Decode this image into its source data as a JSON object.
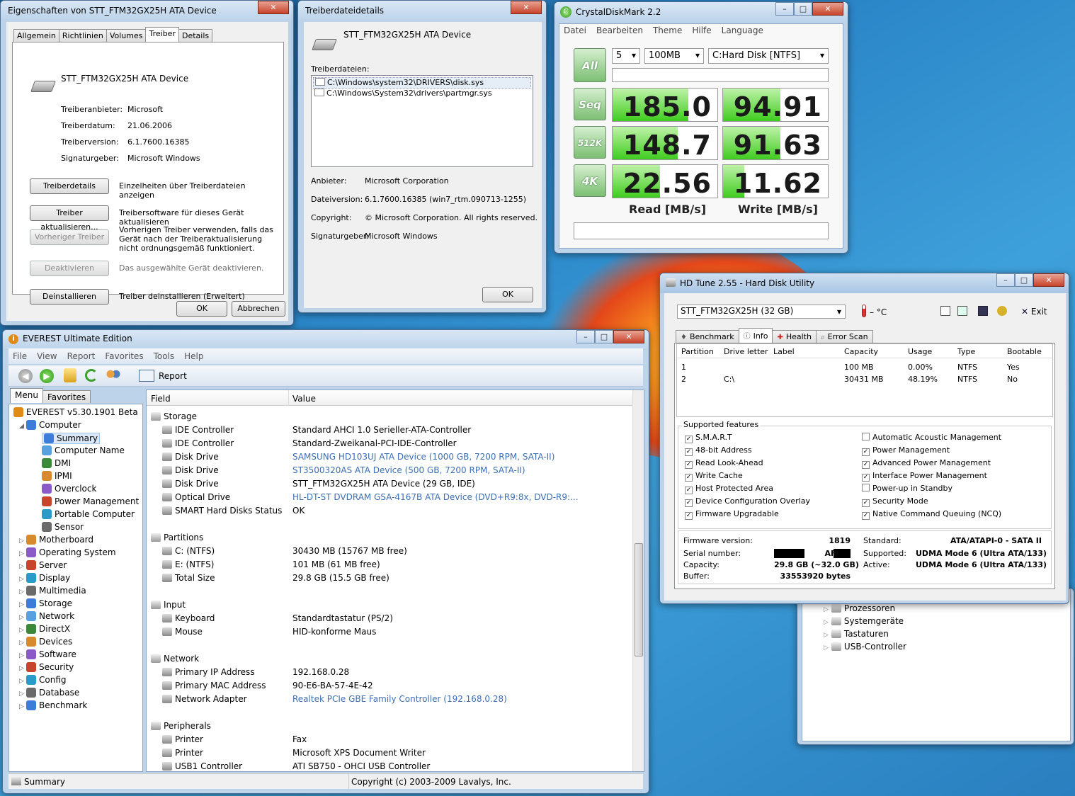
{
  "props": {
    "title": "Eigenschaften von STT_FTM32GX25H ATA Device",
    "tabs": [
      "Allgemein",
      "Richtlinien",
      "Volumes",
      "Treiber",
      "Details"
    ],
    "device": "STT_FTM32GX25H ATA Device",
    "fields": [
      {
        "k": "Treiberanbieter:",
        "v": "Microsoft"
      },
      {
        "k": "Treiberdatum:",
        "v": "21.06.2006"
      },
      {
        "k": "Treiberversion:",
        "v": "6.1.7600.16385"
      },
      {
        "k": "Signaturgeber:",
        "v": "Microsoft Windows"
      }
    ],
    "actions": [
      {
        "btn": "Treiberdetails",
        "desc": "Einzelheiten über Treiberdateien anzeigen"
      },
      {
        "btn": "Treiber aktualisieren...",
        "desc": "Treibersoftware für dieses Gerät aktualisieren"
      },
      {
        "btn": "Vorheriger Treiber",
        "desc": "Vorherigen Treiber verwenden, falls das Gerät nach der Treiberaktualisierung nicht ordnungsgemäß funktioniert."
      },
      {
        "btn": "Deaktivieren",
        "desc": "Das ausgewählte Gerät deaktivieren."
      },
      {
        "btn": "Deinstallieren",
        "desc": "Treiber deinstallieren (Erweitert)"
      }
    ],
    "ok": "OK",
    "cancel": "Abbrechen"
  },
  "details": {
    "title": "Treiberdateidetails",
    "device": "STT_FTM32GX25H ATA Device",
    "files_label": "Treiberdateien:",
    "files": [
      "C:\\Windows\\system32\\DRIVERS\\disk.sys",
      "C:\\Windows\\System32\\drivers\\partmgr.sys"
    ],
    "fields": [
      {
        "k": "Anbieter:",
        "v": "Microsoft Corporation"
      },
      {
        "k": "Dateiversion:",
        "v": "6.1.7600.16385 (win7_rtm.090713-1255)"
      },
      {
        "k": "Copyright:",
        "v": "© Microsoft Corporation. All rights reserved."
      },
      {
        "k": "Signaturgeber:",
        "v": "Microsoft Windows"
      }
    ],
    "ok": "OK"
  },
  "cdm": {
    "title": "CrystalDiskMark 2.2",
    "menu": [
      "Datei",
      "Bearbeiten",
      "Theme",
      "Hilfe",
      "Language"
    ],
    "count": "5",
    "size": "100MB",
    "drive": "C:Hard Disk [NTFS]",
    "all": "All",
    "rows": [
      {
        "label": "Seq",
        "read": "185.0",
        "write": "94.91",
        "read_fill": 0.72,
        "write_fill": 0.55
      },
      {
        "label": "512K",
        "read": "148.7",
        "write": "91.63",
        "read_fill": 0.62,
        "write_fill": 0.55
      },
      {
        "label": "4K",
        "read": "22.56",
        "write": "11.62",
        "read_fill": 0.45,
        "write_fill": 0.2
      }
    ],
    "read_label": "Read [MB/s]",
    "write_label": "Write [MB/s]"
  },
  "hdtune": {
    "title": "HD Tune 2.55 - Hard Disk Utility",
    "drive": "STT_FTM32GX25H (32 GB)",
    "temp": "– °C",
    "exit": "Exit",
    "tabs": [
      "Benchmark",
      "Info",
      "Health",
      "Error Scan"
    ],
    "columns": [
      "Partition",
      "Drive letter",
      "Label",
      "Capacity",
      "Usage",
      "Type",
      "Bootable"
    ],
    "partitions": [
      [
        "1",
        "",
        "",
        "100 MB",
        "0.00%",
        "NTFS",
        "Yes"
      ],
      [
        "2",
        "C:\\",
        "",
        "30431 MB",
        "48.19%",
        "NTFS",
        "No"
      ]
    ],
    "features_label": "Supported features",
    "features_left": [
      {
        "name": "S.M.A.R.T",
        "on": true
      },
      {
        "name": "48-bit Address",
        "on": true
      },
      {
        "name": "Read Look-Ahead",
        "on": true
      },
      {
        "name": "Write Cache",
        "on": true
      },
      {
        "name": "Host Protected Area",
        "on": true
      },
      {
        "name": "Device Configuration Overlay",
        "on": true
      },
      {
        "name": "Firmware Upgradable",
        "on": true
      }
    ],
    "features_right": [
      {
        "name": "Automatic Acoustic Management",
        "on": false
      },
      {
        "name": "Power Management",
        "on": true
      },
      {
        "name": "Advanced Power Management",
        "on": true
      },
      {
        "name": "Interface Power Management",
        "on": true
      },
      {
        "name": "Power-up in Standby",
        "on": false
      },
      {
        "name": "Security Mode",
        "on": true
      },
      {
        "name": "Native Command Queuing (NCQ)",
        "on": true
      }
    ],
    "info_left": [
      {
        "k": "Firmware version:",
        "v": "1819"
      },
      {
        "k": "Serial number:",
        "v": "AFBX-"
      },
      {
        "k": "Capacity:",
        "v": "29.8 GB (~32.0 GB)"
      },
      {
        "k": "Buffer:",
        "v": "33553920 bytes"
      }
    ],
    "info_right": [
      {
        "k": "Standard:",
        "v": "ATA/ATAPI-0 - SATA II"
      },
      {
        "k": "Supported:",
        "v": "UDMA Mode 6 (Ultra ATA/133)"
      },
      {
        "k": "Active:",
        "v": "UDMA Mode 6 (Ultra ATA/133)"
      }
    ]
  },
  "devmgr": {
    "items": [
      "Prozessoren",
      "Systemgeräte",
      "Tastaturen",
      "USB-Controller"
    ]
  },
  "everest": {
    "title": "EVEREST Ultimate Edition",
    "menu": [
      "File",
      "View",
      "Report",
      "Favorites",
      "Tools",
      "Help"
    ],
    "report": "Report",
    "tab_menu": "Menu",
    "tab_fav": "Favorites",
    "tree_root": "EVEREST v5.30.1901 Beta",
    "tree_computer": "Computer",
    "tree_children": [
      "Summary",
      "Computer Name",
      "DMI",
      "IPMI",
      "Overclock",
      "Power Management",
      "Portable Computer",
      "Sensor"
    ],
    "tree_top": [
      "Motherboard",
      "Operating System",
      "Server",
      "Display",
      "Multimedia",
      "Storage",
      "Network",
      "DirectX",
      "Devices",
      "Software",
      "Security",
      "Config",
      "Database",
      "Benchmark"
    ],
    "col_field": "Field",
    "col_value": "Value",
    "sections": [
      {
        "title": "Storage",
        "rows": [
          [
            "IDE Controller",
            "Standard AHCI 1.0 Serieller-ATA-Controller",
            false
          ],
          [
            "IDE Controller",
            "Standard-Zweikanal-PCI-IDE-Controller",
            false
          ],
          [
            "Disk Drive",
            "SAMSUNG HD103UJ ATA Device  (1000 GB, 7200 RPM, SATA-II)",
            true
          ],
          [
            "Disk Drive",
            "ST3500320AS ATA Device  (500 GB, 7200 RPM, SATA-II)",
            true
          ],
          [
            "Disk Drive",
            "STT_FTM32GX25H ATA Device  (29 GB, IDE)",
            false
          ],
          [
            "Optical Drive",
            "HL-DT-ST DVDRAM GSA-4167B ATA Device  (DVD+R9:8x, DVD-R9:...",
            true
          ],
          [
            "SMART Hard Disks Status",
            "OK",
            false
          ]
        ]
      },
      {
        "title": "Partitions",
        "rows": [
          [
            "C: (NTFS)",
            "30430 MB (15767 MB free)",
            false
          ],
          [
            "E: (NTFS)",
            "101 MB (61 MB free)",
            false
          ],
          [
            "Total Size",
            "29.8 GB (15.5 GB free)",
            false
          ]
        ]
      },
      {
        "title": "Input",
        "rows": [
          [
            "Keyboard",
            "Standardtastatur (PS/2)",
            false
          ],
          [
            "Mouse",
            "HID-konforme Maus",
            false
          ]
        ]
      },
      {
        "title": "Network",
        "rows": [
          [
            "Primary IP Address",
            "192.168.0.28",
            false
          ],
          [
            "Primary MAC Address",
            "90-E6-BA-57-4E-42",
            false
          ],
          [
            "Network Adapter",
            "Realtek PCIe GBE Family Controller  (192.168.0.28)",
            true
          ]
        ]
      },
      {
        "title": "Peripherals",
        "rows": [
          [
            "Printer",
            "Fax",
            false
          ],
          [
            "Printer",
            "Microsoft XPS Document Writer",
            false
          ],
          [
            "USB1 Controller",
            "ATI SB750 - OHCI USB Controller",
            false
          ]
        ]
      }
    ],
    "status_left": "Summary",
    "status_right": "Copyright (c) 2003-2009 Lavalys, Inc."
  }
}
